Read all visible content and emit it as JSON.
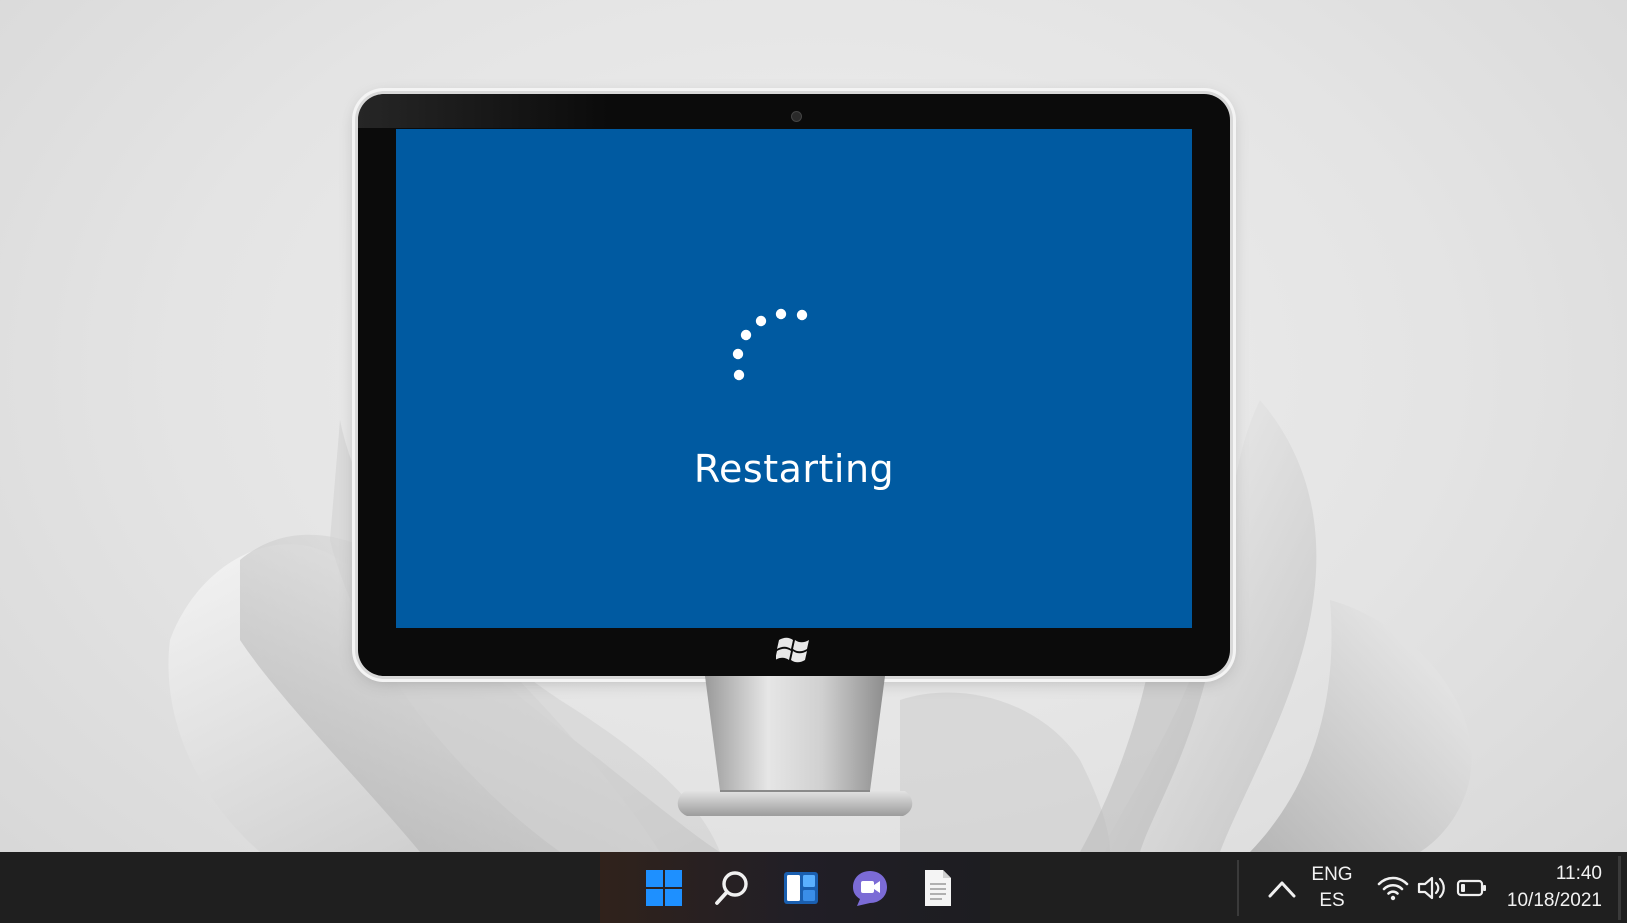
{
  "screen": {
    "status_text": "Restarting",
    "background_color": "#005aa1",
    "spinner_icon": "loading-dots-icon"
  },
  "taskbar": {
    "pinned_apps": [
      {
        "name": "start-button",
        "icon": "windows-logo-icon"
      },
      {
        "name": "search-button",
        "icon": "search-icon"
      },
      {
        "name": "widgets-button",
        "icon": "widgets-icon"
      },
      {
        "name": "teams-chat-button",
        "icon": "video-chat-icon"
      },
      {
        "name": "file-button",
        "icon": "document-icon"
      }
    ],
    "tray": {
      "language_line1": "ENG",
      "language_line2": "ES",
      "time": "11:40",
      "date": "10/18/2021",
      "icons": [
        "chevron-up-icon",
        "wifi-icon",
        "volume-icon",
        "battery-icon"
      ]
    }
  },
  "colors": {
    "taskbar_bg": "#1f1f1f",
    "windows_blue": "#1e90ff",
    "chat_purple": "#7b6bd6"
  }
}
